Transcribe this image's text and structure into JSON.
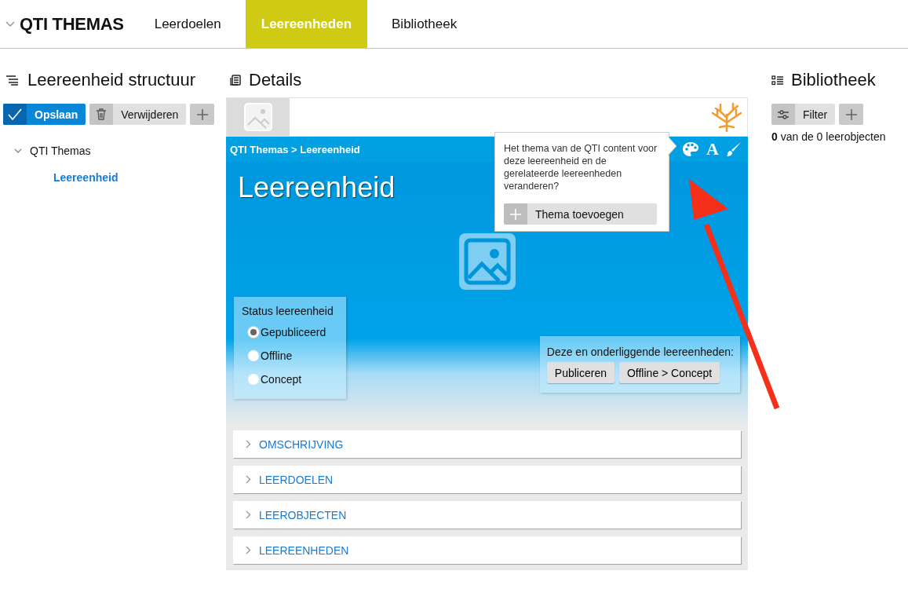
{
  "app": {
    "title": "QTI THEMAS"
  },
  "tabs": [
    {
      "label": "Leerdoelen",
      "selected": false
    },
    {
      "label": "Leereenheden",
      "selected": true
    },
    {
      "label": "Bibliotheek",
      "selected": false
    }
  ],
  "structure": {
    "title": "Leereenheid structuur",
    "save": "Opslaan",
    "delete": "Verwijderen",
    "tree": [
      {
        "label": "QTI Themas",
        "expanded": true,
        "selected": false,
        "children": [
          {
            "label": "Leereenheid",
            "selected": true
          }
        ]
      }
    ]
  },
  "details": {
    "title": "Details",
    "breadcrumb": "QTI Themas > Leereenheid",
    "heading": "Leereenheid",
    "tools": [
      {
        "kind": "palette"
      },
      {
        "kind": "font",
        "glyph": "A"
      },
      {
        "kind": "brush"
      }
    ],
    "popover": {
      "text": "Het thema van de QTI content voor deze leereenheid en de gerelateerde leereenheden veranderen?",
      "button": "Thema toevoegen"
    },
    "status": {
      "label": "Status leereenheid",
      "options": [
        {
          "label": "Gepubliceerd",
          "selected": true
        },
        {
          "label": "Offline",
          "selected": false
        },
        {
          "label": "Concept",
          "selected": false
        }
      ]
    },
    "bulk": {
      "label": "Deze en onderliggende leereenheden:",
      "buttons": [
        "Publiceren",
        "Offline > Concept"
      ]
    },
    "sections": [
      {
        "label": "OMSCHRIJVING",
        "expanded": false
      },
      {
        "label": "LEERDOELEN",
        "expanded": false
      },
      {
        "label": "LEEROBJECTEN",
        "expanded": false
      },
      {
        "label": "LEEREENHEDEN",
        "expanded": false
      }
    ]
  },
  "library": {
    "title": "Bibliotheek",
    "filter": "Filter",
    "count": "**0** van de 0 leerobjecten"
  }
}
